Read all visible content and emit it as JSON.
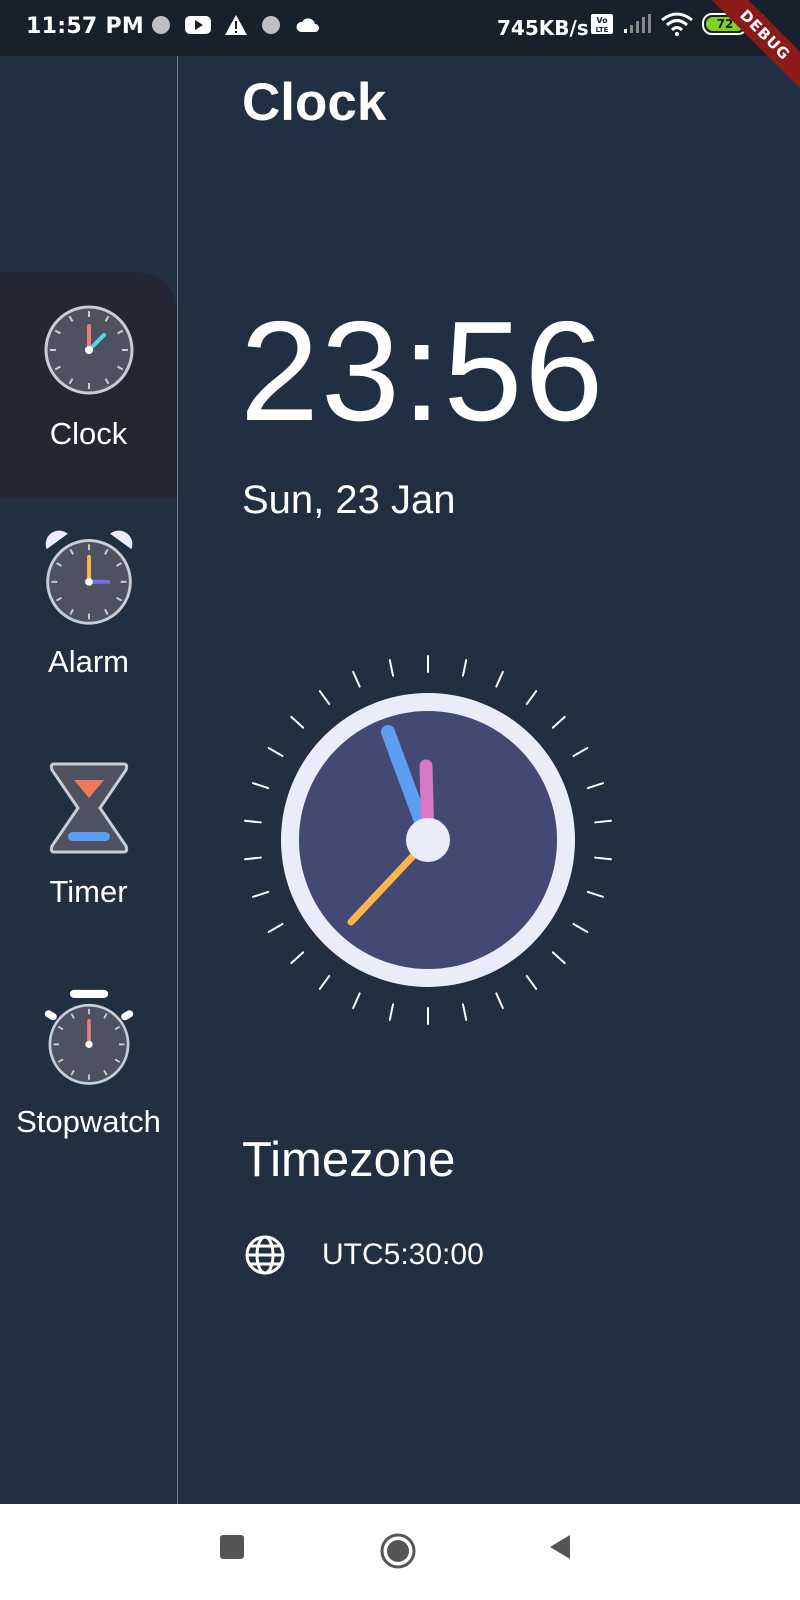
{
  "status_bar": {
    "time": "11:57 PM",
    "net_speed": "745KB/s",
    "battery": "72",
    "debug_banner": "DEBUG"
  },
  "sidebar": {
    "items": [
      {
        "label": "Clock",
        "icon": "clock-icon",
        "active": true
      },
      {
        "label": "Alarm",
        "icon": "alarm-icon",
        "active": false
      },
      {
        "label": "Timer",
        "icon": "hourglass-icon",
        "active": false
      },
      {
        "label": "Stopwatch",
        "icon": "stopwatch-icon",
        "active": false
      }
    ]
  },
  "main": {
    "title": "Clock",
    "digital_time": "23:56",
    "date": "Sun, 23 Jan",
    "timezone_title": "Timezone",
    "timezone_value": "UTC5:30:00"
  },
  "colors": {
    "background": "#202F41",
    "active_nav": "#242634",
    "clock_face": "#444974",
    "clock_rim": "#EAECFA",
    "hour_hand": "#E46FC0",
    "minute_hand": "#5E9EF2",
    "second_hand": "#FFB54B"
  }
}
